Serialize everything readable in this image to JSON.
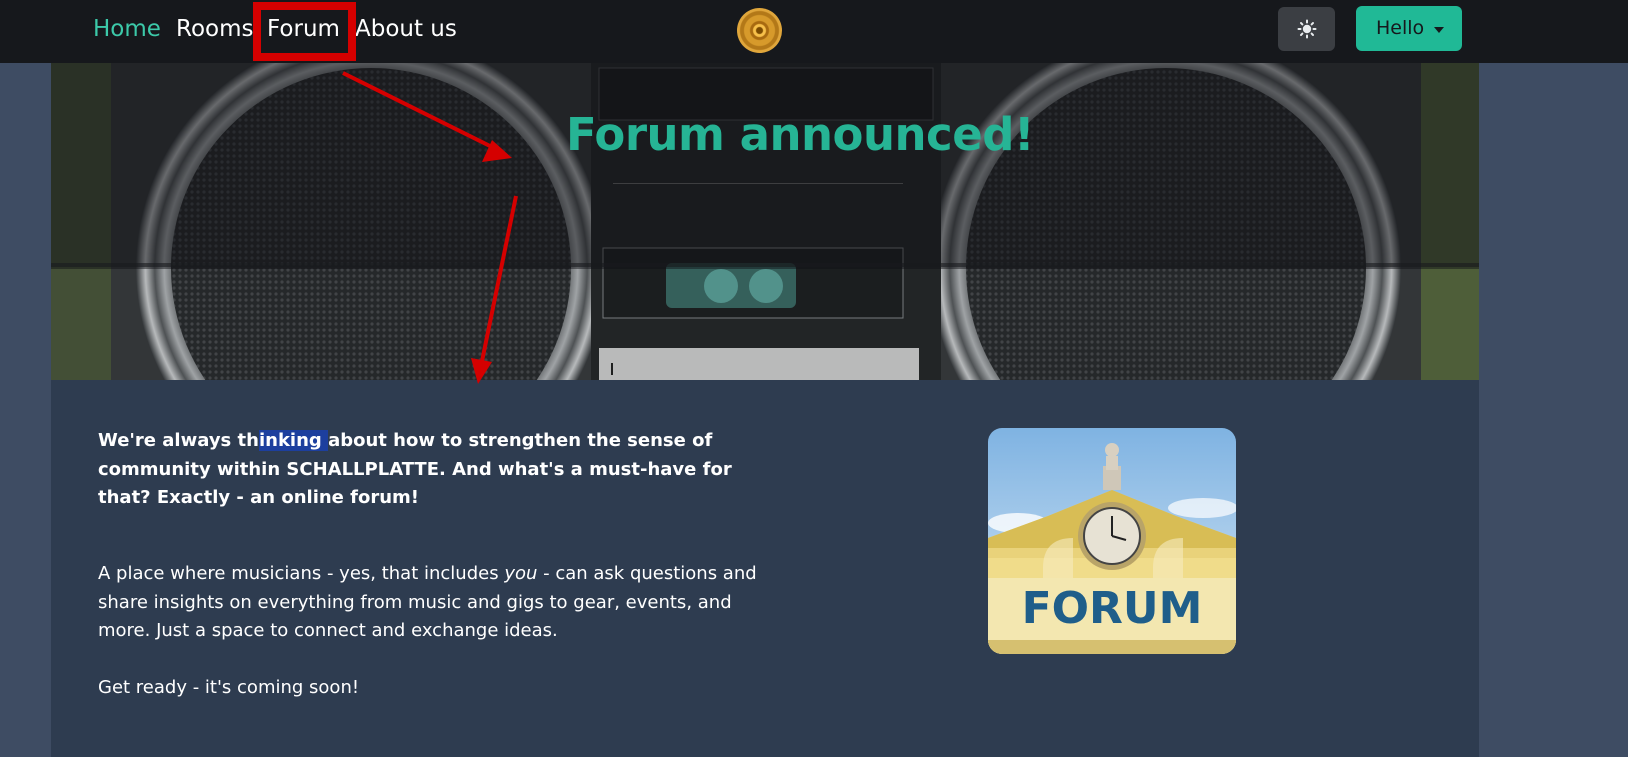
{
  "nav": {
    "items": [
      {
        "label": "Home",
        "active": true
      },
      {
        "label": "Rooms",
        "active": false
      },
      {
        "label": "Forum",
        "active": false
      },
      {
        "label": "About us",
        "active": false
      }
    ],
    "logo_icon": "vinyl-record-icon",
    "theme_toggle_icon": "sun-icon",
    "user_menu_label": "Hello"
  },
  "hero": {
    "title": "Forum announced!"
  },
  "content": {
    "lead_part1": "We're always th",
    "lead_selected": "inking ",
    "lead_part2": "about how to strengthen the sense of community within SCHALLPLATTE. And what's a must-have for that? Exactly - an online forum!",
    "body_part1": "A place where musicians - yes, that includes ",
    "body_emphasis": "you",
    "body_part2": " - can ask questions and share insights on everything from music and gigs to gear, events, and more. Just a space to connect and exchange ideas.",
    "closing": "Get ready - it's coming soon!",
    "image_sign_text": "FORUM"
  },
  "colors": {
    "navbar_bg": "#16181c",
    "accent": "#20b996",
    "page_bg": "#3e4c63",
    "content_bg": "#2e3c50",
    "annotation": "#d50000"
  }
}
